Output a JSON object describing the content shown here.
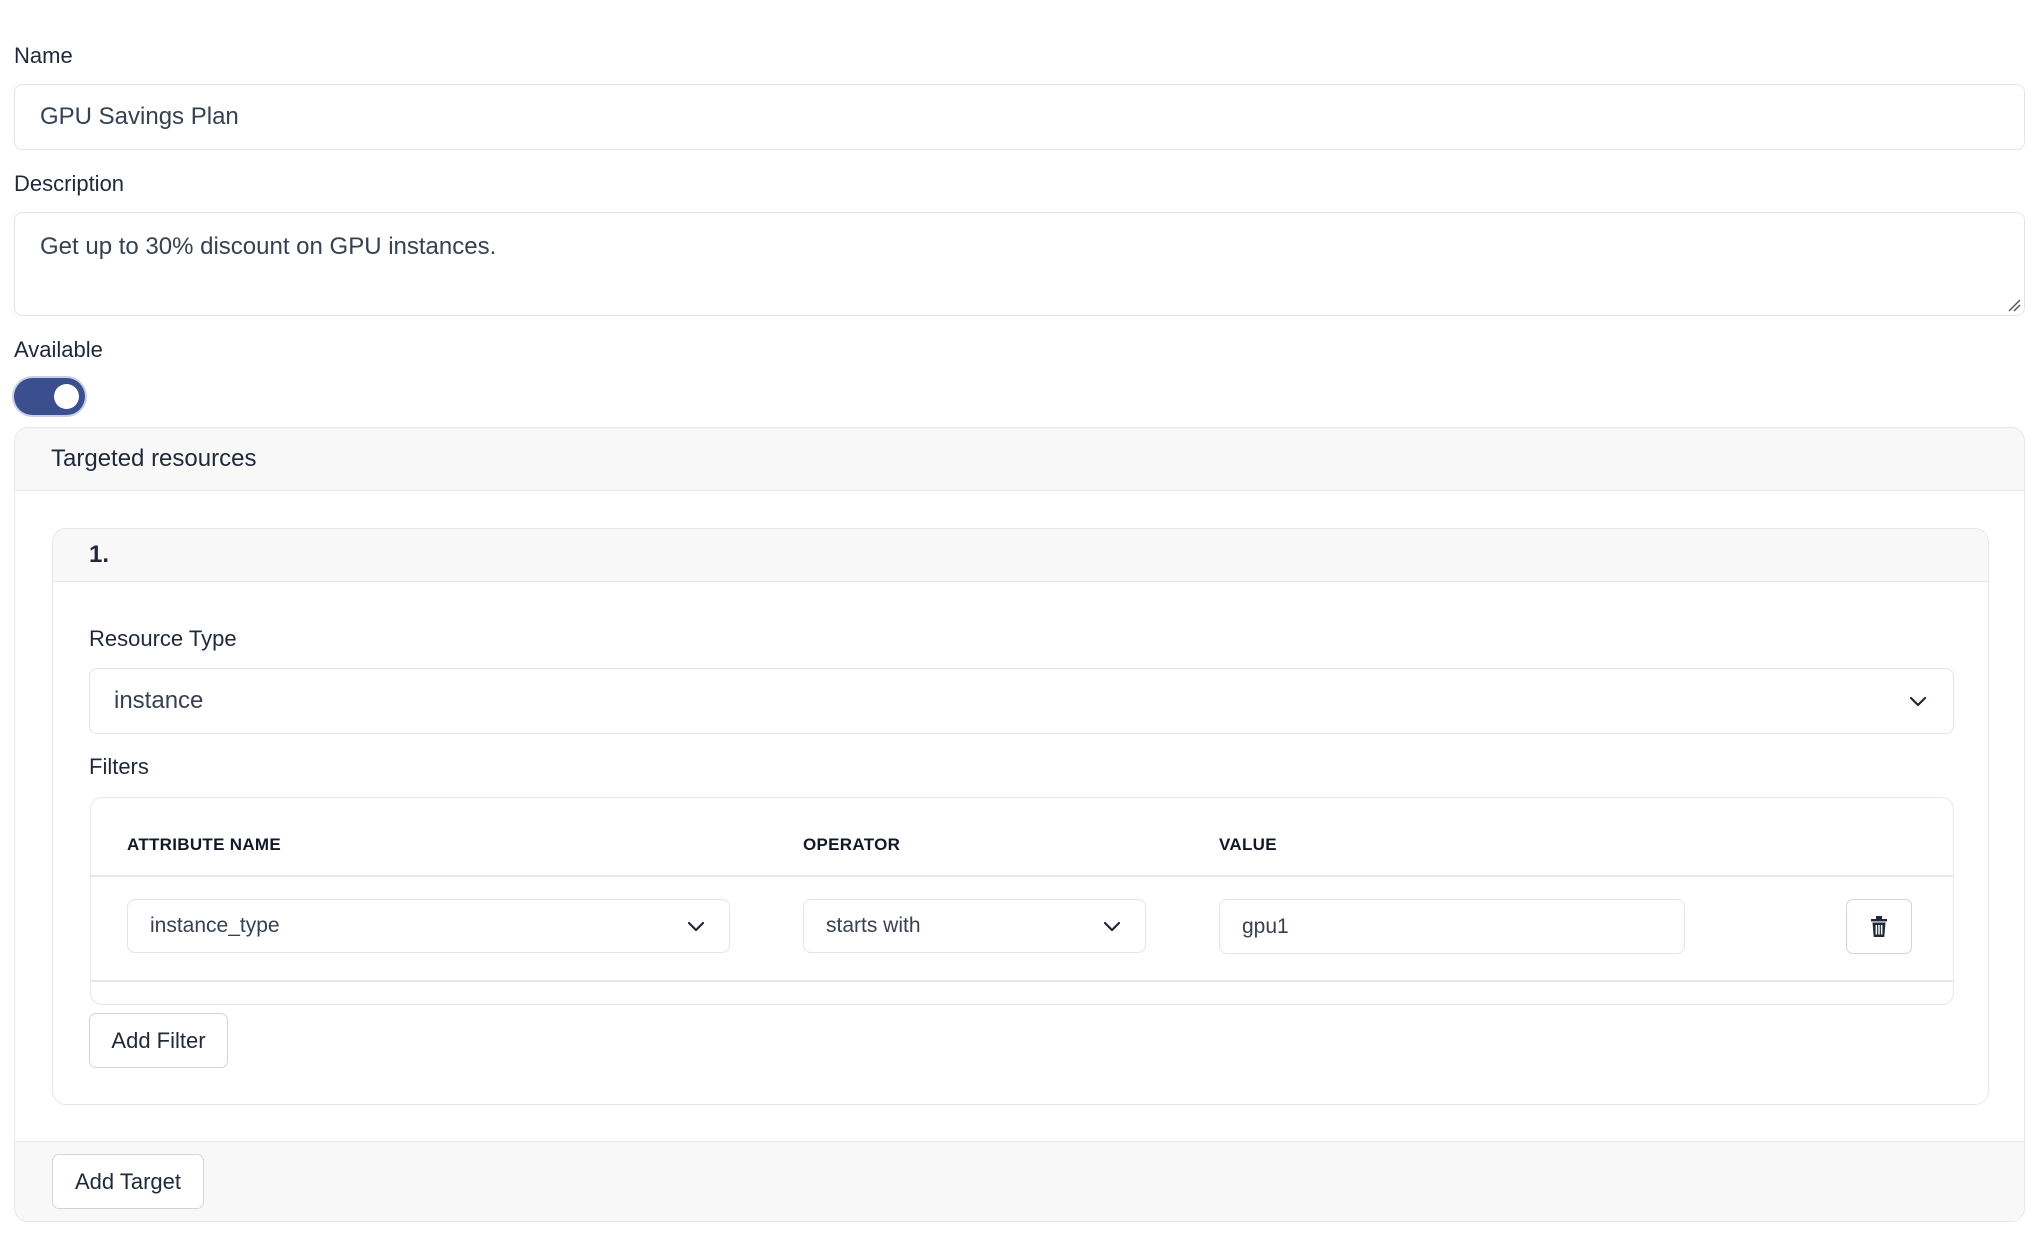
{
  "form": {
    "name_label": "Name",
    "name_value": "GPU Savings Plan",
    "description_label": "Description",
    "description_value": "Get up to 30% discount on GPU instances.",
    "available_label": "Available",
    "available_on": true
  },
  "targeted": {
    "title": "Targeted resources",
    "targets": [
      {
        "index_label": "1.",
        "resource_type_label": "Resource Type",
        "resource_type_value": "instance",
        "filters_label": "Filters",
        "columns": [
          "ATTRIBUTE NAME",
          "OPERATOR",
          "VALUE"
        ],
        "filters": [
          {
            "attribute": "instance_type",
            "operator": "starts with",
            "value": "gpu1"
          }
        ],
        "add_filter_label": "Add Filter"
      }
    ],
    "add_target_label": "Add Target"
  },
  "icons": {
    "toggle": "toggle-switch",
    "chevron": "chevron-down-icon",
    "delete": "trash-icon",
    "resize": "resize-grip-icon"
  },
  "colors": {
    "accent": "#3b4f8e",
    "border": "#e3e5e8",
    "panel_bg": "#f8f8f9"
  }
}
